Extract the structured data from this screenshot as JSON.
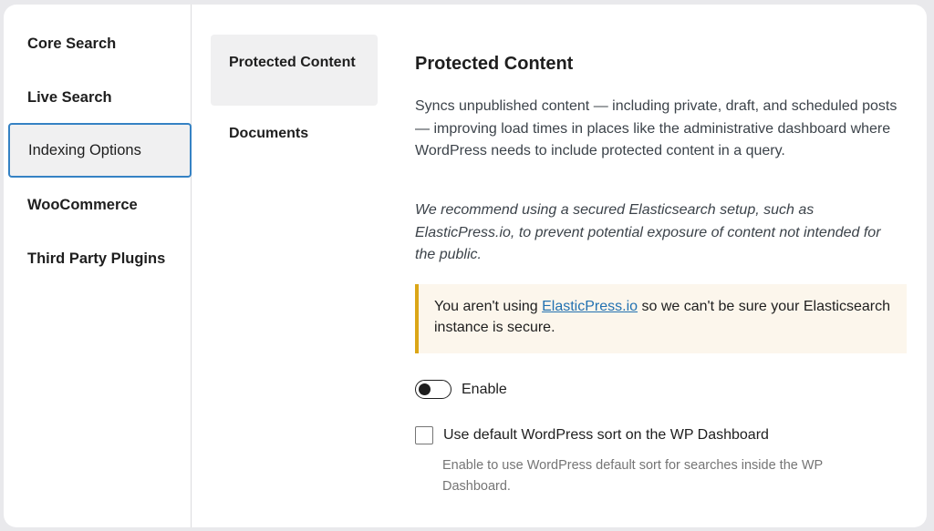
{
  "nav": {
    "items": [
      {
        "label": "Core Search",
        "active": false
      },
      {
        "label": "Live Search",
        "active": false
      },
      {
        "label": "Indexing Options",
        "active": true
      },
      {
        "label": "WooCommerce",
        "active": false
      },
      {
        "label": "Third Party Plugins",
        "active": false
      }
    ]
  },
  "tabs": [
    {
      "label": "Protected Content",
      "active": true
    },
    {
      "label": "Documents",
      "active": false
    }
  ],
  "content": {
    "title": "Protected Content",
    "description": "Syncs unpublished content — including private, draft, and scheduled posts — improving load times in places like the administrative dashboard where WordPress needs to include protected content in a query.",
    "note": "We recommend using a secured Elasticsearch setup, such as ElasticPress.io, to prevent potential exposure of content not intended for the public.",
    "warning": {
      "prefix": "You aren't using ",
      "link": "ElasticPress.io",
      "suffix": " so we can't be sure your Elasticsearch instance is secure."
    },
    "toggle": {
      "label": "Enable",
      "checked": false
    },
    "checkbox": {
      "label": "Use default WordPress sort on the WP Dashboard",
      "checked": false,
      "help": "Enable to use WordPress default sort for searches inside the WP Dashboard."
    }
  },
  "colors": {
    "accent": "#3582c4",
    "link": "#2271b1",
    "warning_border": "#dba617",
    "warning_bg": "#fcf6ec"
  }
}
